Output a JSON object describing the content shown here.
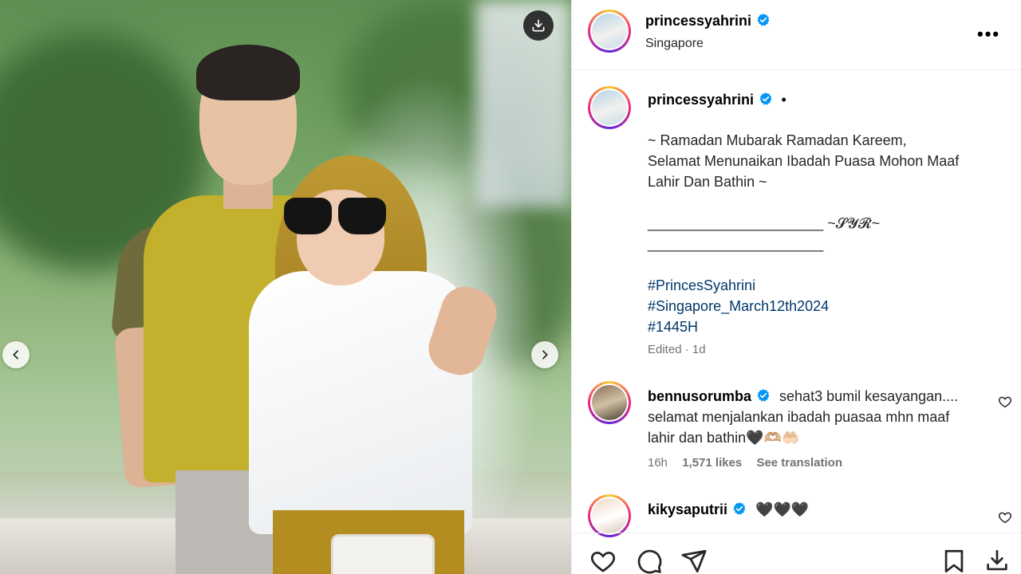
{
  "post": {
    "author": {
      "username": "princessyahrini",
      "location": "Singapore"
    },
    "caption": {
      "username": "princessyahrini",
      "dot": "•",
      "lines": [
        "~ Ramadan Mubarak Ramadan Kareem,",
        "Selamat Menunaikan Ibadah Puasa Mohon Maaf",
        "Lahir Dan Bathin ~",
        "",
        "______________________ ~𝓢𝓨𝓡~",
        "______________________",
        ""
      ],
      "hashtags": [
        "#PrincesSyahrini",
        "#Singapore_March12th2024",
        "#1445H"
      ],
      "edited_label": "Edited",
      "dot_sep": "·",
      "age": "1d"
    },
    "comments": [
      {
        "username": "bennusorumba",
        "text_line1": "sehat3 bumil kesayangan....",
        "text_line2": "selamat menjalankan ibadah puasaa mhn maaf",
        "text_line3": "lahir dan bathin🖤🫶🏼🤲🏻",
        "time": "16h",
        "likes": "1,571 likes",
        "see_translation": "See translation"
      },
      {
        "username": "kikysaputrii",
        "text_line1": "🖤🖤🖤"
      }
    ]
  },
  "icons": {
    "verified_color": "#0095f6",
    "like": "heart-icon",
    "comment": "comment-icon",
    "share": "send-icon",
    "save": "bookmark-icon",
    "download": "download-icon",
    "more": "more-options-icon"
  }
}
